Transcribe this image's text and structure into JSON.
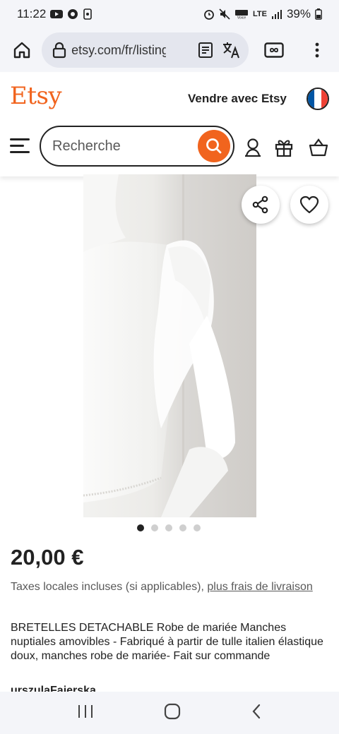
{
  "status_bar": {
    "time": "11:22",
    "battery": "39%",
    "network": "LTE"
  },
  "browser": {
    "url": "etsy.com/fr/listing",
    "tab_count_icon": "infinity-tabs-icon"
  },
  "header": {
    "logo": "Etsy",
    "sell_label": "Vendre avec Etsy",
    "search_placeholder": "Recherche",
    "colors": {
      "brand": "#f1641e",
      "flag_blue": "#0055a4",
      "flag_red": "#ef4135"
    }
  },
  "gallery": {
    "image_count": 5,
    "active_index": 0
  },
  "product": {
    "price": "20,00 €",
    "tax_text": "Taxes locales incluses (si applicables),",
    "shipping_link": "plus frais de livraison",
    "title": "BRETELLES DETACHABLE Robe de mariée Manches nuptiales amovibles - Fabriqué à partir de tulle italien élastique doux, manches robe de mariée- Fait sur commande",
    "shop_name": "urszulaFajerska"
  }
}
